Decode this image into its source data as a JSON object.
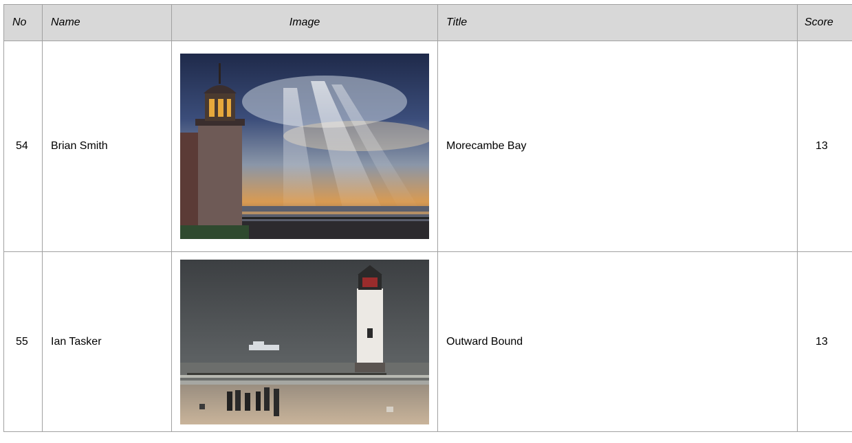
{
  "table": {
    "columns": {
      "no": "No",
      "name": "Name",
      "image": "Image",
      "title": "Title",
      "score": "Score"
    },
    "rows": [
      {
        "no": "54",
        "name": "Brian Smith",
        "image_desc": "lighthouse-at-sunset-photo",
        "title": "Morecambe Bay",
        "score": "13"
      },
      {
        "no": "55",
        "name": "Ian Tasker",
        "image_desc": "lighthouse-on-beach-photo",
        "title": "Outward Bound",
        "score": "13"
      }
    ]
  }
}
